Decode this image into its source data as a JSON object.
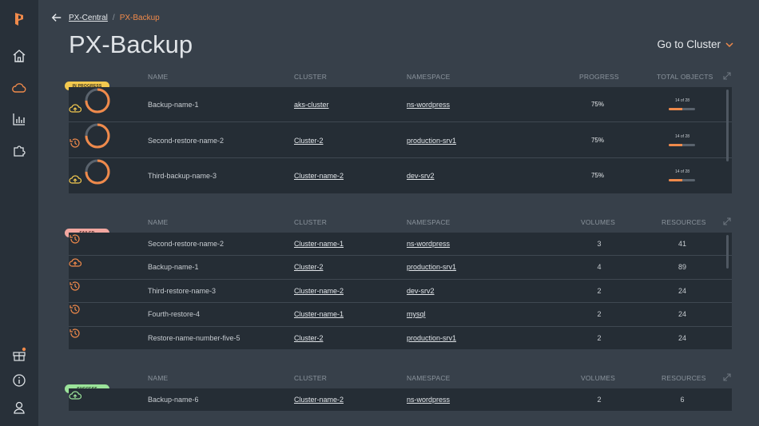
{
  "breadcrumb": {
    "parent": "PX-Central",
    "separator": "/",
    "current": "PX-Backup"
  },
  "page_title": "PX-Backup",
  "goto_cluster": "Go to Cluster",
  "colors": {
    "accent": "#f08a4b",
    "in_progress": "#f3c94f",
    "failed": "#f2a7a0",
    "success": "#9be39a",
    "sidebar": "#283039"
  },
  "sidebar": {
    "top_icons": [
      "portworx-logo-icon",
      "home-icon",
      "cloud-icon",
      "chart-icon",
      "puzzle-icon"
    ],
    "bottom_icons": [
      "gift-icon",
      "info-icon",
      "user-icon"
    ]
  },
  "in_progress": {
    "badge": "IN PROGRESS",
    "headers": {
      "name": "NAME",
      "cluster": "CLUSTER",
      "namespace": "NAMESPACE",
      "progress": "PROGRESS",
      "total": "TOTAL OBJECTS"
    },
    "rows": [
      {
        "type": "backup",
        "name": "Backup-name-1",
        "cluster": "aks-cluster",
        "namespace": "ns-wordpress",
        "progress": "75%",
        "progress_value": 0.75,
        "objects": "14 of 28",
        "objects_fraction": 0.5
      },
      {
        "type": "restore",
        "name": "Second-restore-name-2",
        "cluster": "Cluster-2",
        "namespace": "production-srv1",
        "progress": "75%",
        "progress_value": 0.75,
        "objects": "14 of 28",
        "objects_fraction": 0.5
      },
      {
        "type": "backup",
        "name": "Third-backup-name-3",
        "cluster": "Cluster-name-2",
        "namespace": "dev-srv2",
        "progress": "75%",
        "progress_value": 0.75,
        "objects": "14 of 28",
        "objects_fraction": 0.5
      }
    ]
  },
  "failed": {
    "badge": "FAILED",
    "headers": {
      "name": "NAME",
      "cluster": "CLUSTER",
      "namespace": "NAMESPACE",
      "volumes": "VOLUMES",
      "resources": "RESOURCES"
    },
    "rows": [
      {
        "type": "restore",
        "name": "Second-restore-name-2",
        "cluster": "Cluster-name-1",
        "namespace": "ns-wordpress",
        "volumes": "3",
        "resources": "41"
      },
      {
        "type": "backup",
        "name": "Backup-name-1",
        "cluster": "Cluster-2",
        "namespace": "production-srv1",
        "volumes": "4",
        "resources": "89"
      },
      {
        "type": "restore",
        "name": "Third-restore-name-3",
        "cluster": "Cluster-name-2",
        "namespace": "dev-srv2",
        "volumes": "2",
        "resources": "24"
      },
      {
        "type": "restore",
        "name": "Fourth-restore-4",
        "cluster": "Cluster-name-1",
        "namespace": "mysql",
        "volumes": "2",
        "resources": "24"
      },
      {
        "type": "restore",
        "name": "Restore-name-number-five-5",
        "cluster": "Cluster-2",
        "namespace": "production-srv1",
        "volumes": "2",
        "resources": "24"
      }
    ]
  },
  "success": {
    "badge": "SUCCESS",
    "headers": {
      "name": "NAME",
      "cluster": "CLUSTER",
      "namespace": "NAMESPACE",
      "volumes": "VOLUMES",
      "resources": "RESOURCES"
    },
    "rows": [
      {
        "type": "backup",
        "name": "Backup-name-6",
        "cluster": "Cluster-name-2",
        "namespace": "ns-wordpress",
        "volumes": "2",
        "resources": "6"
      }
    ]
  }
}
